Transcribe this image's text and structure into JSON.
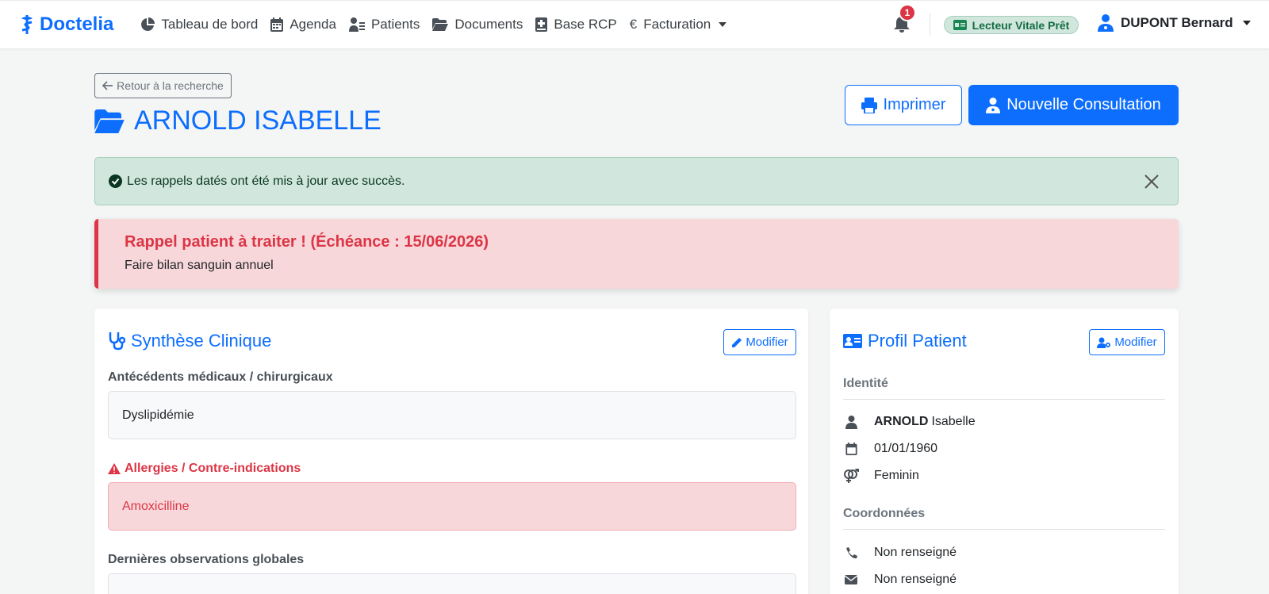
{
  "brand": {
    "name": "Doctelia"
  },
  "nav": {
    "items": [
      {
        "label": "Tableau de bord",
        "icon": "chart-pie-icon"
      },
      {
        "label": "Agenda",
        "icon": "calendar-icon"
      },
      {
        "label": "Patients",
        "icon": "patients-icon"
      },
      {
        "label": "Documents",
        "icon": "folder-icon"
      },
      {
        "label": "Base RCP",
        "icon": "book-medical-icon"
      },
      {
        "label": "Facturation",
        "icon": "euro-icon"
      }
    ]
  },
  "notifications": {
    "count": "1"
  },
  "vitale": {
    "label": "Lecteur Vitale Prêt"
  },
  "user": {
    "name": "DUPONT Bernard"
  },
  "header": {
    "back_label": "Retour à la recherche",
    "patient_title": "ARNOLD ISABELLE",
    "print_label": "Imprimer",
    "new_consultation_label": "Nouvelle Consultation"
  },
  "alert_success": {
    "text": "Les rappels datés ont été mis à jour avec succès."
  },
  "alert_reminder": {
    "title": "Rappel patient à traiter ! (Échéance : 15/06/2026)",
    "text": "Faire bilan sanguin annuel"
  },
  "synthese": {
    "title": "Synthèse Clinique",
    "edit_label": "Modifier",
    "antecedents_label": "Antécédents médicaux / chirurgicaux",
    "antecedents_value": "Dyslipidémie",
    "allergies_label": "Allergies / Contre-indications",
    "allergies_value": "Amoxicilline",
    "observations_label": "Dernières observations globales"
  },
  "profil": {
    "title": "Profil Patient",
    "edit_label": "Modifier",
    "identity_heading": "Identité",
    "last_name": "ARNOLD",
    "first_name": "Isabelle",
    "birth_date": "01/01/1960",
    "sex": "Feminin",
    "contact_heading": "Coordonnées",
    "phone": "Non renseigné",
    "email": "Non renseigné"
  },
  "colors": {
    "primary": "#0d6efd",
    "danger": "#dc3545",
    "success_bg": "#d1e7dd"
  }
}
